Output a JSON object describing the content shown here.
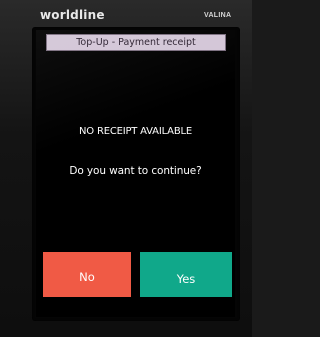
{
  "device": {
    "brand": "worldline",
    "model": "VALINA"
  },
  "screen": {
    "title": "Top-Up - Payment receipt",
    "message": "NO RECEIPT AVAILABLE",
    "question": "Do you want to continue?",
    "buttons": {
      "no_label": "No",
      "yes_label": "Yes"
    }
  },
  "colors": {
    "title_bar": "#d3c6d7",
    "no_button": "#f05a45",
    "yes_button": "#10a88a"
  }
}
